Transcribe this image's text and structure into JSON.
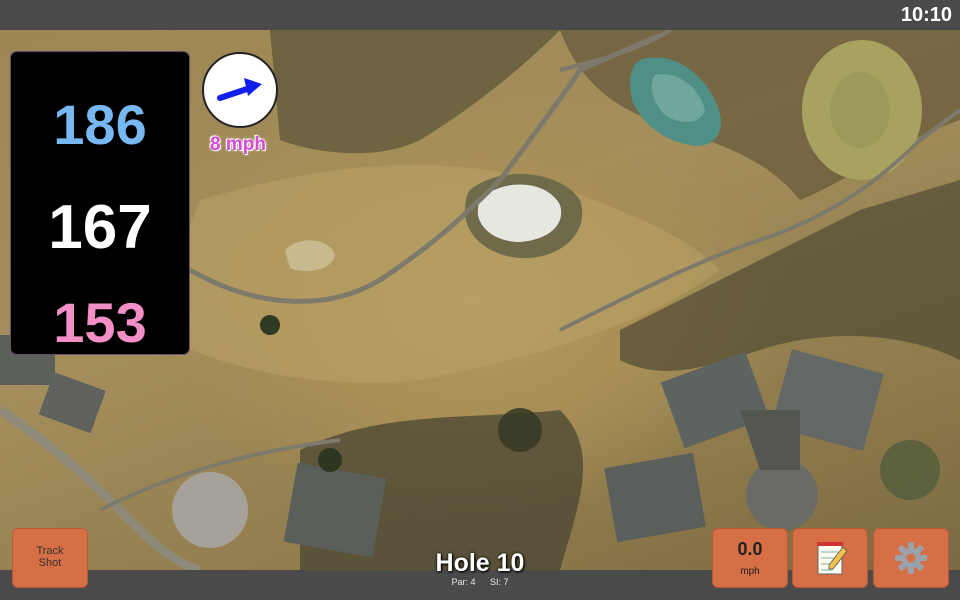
{
  "status": {
    "time": "10:10"
  },
  "distances": {
    "back": "186",
    "middle": "167",
    "front": "153"
  },
  "wind": {
    "speed_label": "8 mph",
    "arrow_color": "#1020e8"
  },
  "hole": {
    "title": "Hole 10",
    "par": "Par: 4",
    "si": "SI: 7"
  },
  "buttons": {
    "track_shot": {
      "line1": "Track",
      "line2": "Shot"
    },
    "speed": {
      "value": "0.0",
      "unit": "mph"
    },
    "notes_icon": "notepad-icon",
    "settings_icon": "gear-icon"
  },
  "colors": {
    "back_distance": "#78b8f2",
    "middle_distance": "#ffffff",
    "front_distance": "#f28fc6",
    "button": "#d66f45",
    "wind_text": "#d64ad6"
  }
}
